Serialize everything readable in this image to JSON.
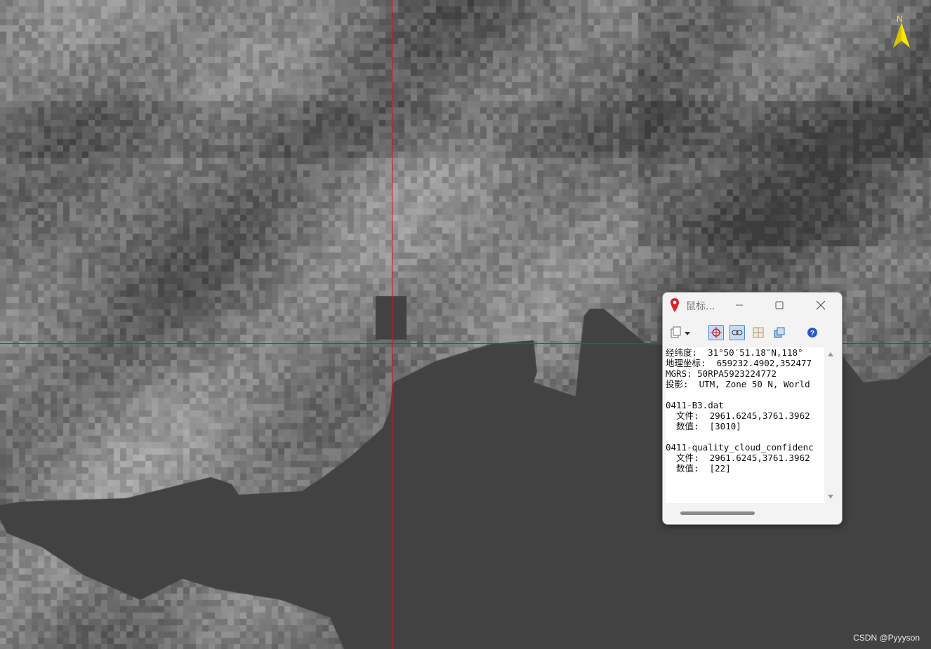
{
  "map": {
    "north_label": "N",
    "watermark": "CSDN @Pyyyson",
    "colors": {
      "crosshair": "#e0101a",
      "north_arrow": "#ffe600",
      "water": "#424242"
    }
  },
  "cursor_window": {
    "title": "鼠标...",
    "title_icon": "map-pin-icon",
    "controls": {
      "minimize": "–",
      "maximize": "☐",
      "close": "✕"
    },
    "toolbar": [
      "copy-dropdown-icon",
      "crosshair-locate-icon",
      "link-icon",
      "grid-icon",
      "layers-icon",
      "help-icon"
    ],
    "lines": [
      "经纬度:  31°50′51.18″N,118°",
      "地理坐标:  659232.4902,352477",
      "MGRS: 50RPA5923224772",
      "投影:  UTM, Zone 50 N, World",
      "",
      "0411-B3.dat",
      "  文件:  2961.6245,3761.3962",
      "  数值:  [3010]",
      "",
      "0411-quality_cloud_confidenc",
      "  文件:  2961.6245,3761.3962",
      "  数值:  [22]"
    ]
  }
}
